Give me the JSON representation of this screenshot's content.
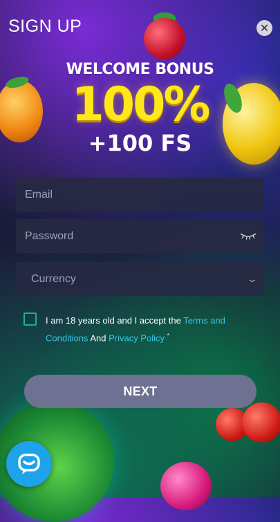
{
  "header": {
    "title": "SIGN UP",
    "close_icon": "close-icon"
  },
  "bonus": {
    "line1": "WELCOME BONUS",
    "line2": "100%",
    "line3": "+100 FS"
  },
  "form": {
    "email_placeholder": "Email",
    "password_placeholder": "Password",
    "password_icon": "eye-closed-icon",
    "currency_label": "Currency",
    "currency_icon": "chevron-down-icon",
    "terms": {
      "text1": "I am 18 years old and I accept the ",
      "link1": "Terms and Conditions",
      "text2": " And ",
      "link2": "Privacy Policy",
      "asterisk": "*"
    },
    "next_label": "NEXT"
  },
  "chat": {
    "icon": "chat-icon"
  },
  "colors": {
    "accent": "#19b38b",
    "link": "#35c6e6",
    "bonus_yellow": "#ffe81a",
    "button": "#6e7192",
    "chat": "#1ea2ea"
  }
}
